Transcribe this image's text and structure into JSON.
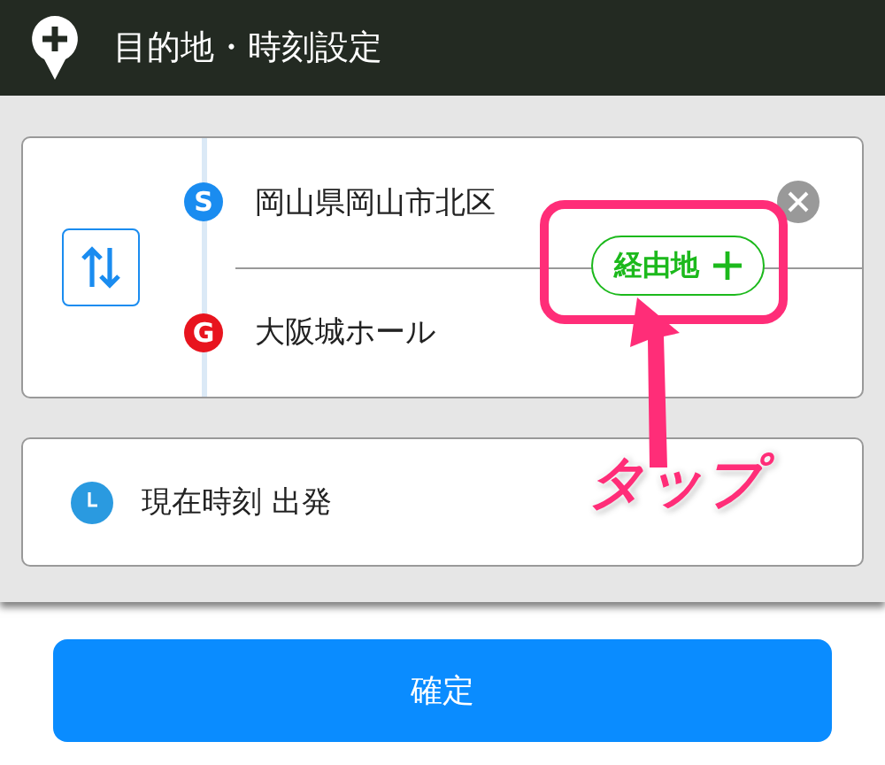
{
  "header": {
    "title": "目的地・時刻設定"
  },
  "route": {
    "points": [
      {
        "kind": "start",
        "badge": "S",
        "name": "岡山県岡山市北区",
        "clearable": true
      },
      {
        "kind": "goal",
        "badge": "G",
        "name": "大阪城ホール",
        "clearable": false
      }
    ],
    "waypoint_button": "経由地"
  },
  "time": {
    "label": "現在時刻 出発"
  },
  "confirm_button": "確定",
  "annotation": {
    "label": "タップ"
  }
}
